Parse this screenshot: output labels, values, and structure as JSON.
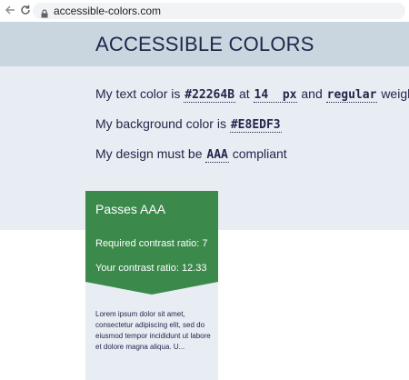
{
  "browser": {
    "url": "accessible-colors.com"
  },
  "header": {
    "title": "ACCESSIBLE COLORS"
  },
  "form": {
    "text_prefix": "My text color is",
    "text_color": "#22264B",
    "at": "at",
    "size_value": "14",
    "size_unit": "px",
    "and": "and",
    "weight_value": "regular",
    "weight_suffix": "weight",
    "bg_prefix": "My background color is",
    "bg_color": "#E8EDF3",
    "compliance_prefix": "My design must be",
    "compliance_value": "AAA",
    "compliance_suffix": "compliant"
  },
  "result": {
    "status": "Passes AAA",
    "required": "Required contrast ratio: 7",
    "yours": "Your contrast ratio: 12.33",
    "sample": "Lorem ipsum dolor sit amet, consectetur adipiscing elit, sed do eiusmod tempor incididunt ut labore et dolore magna aliqua. U..."
  },
  "icons": {
    "back": "back-arrow-icon",
    "reload": "reload-icon",
    "lock": "lock-icon"
  },
  "colors": {
    "text": "#22264b",
    "background": "#e8edf3",
    "header": "#c9d6e0",
    "pass": "#3b8a4c"
  }
}
